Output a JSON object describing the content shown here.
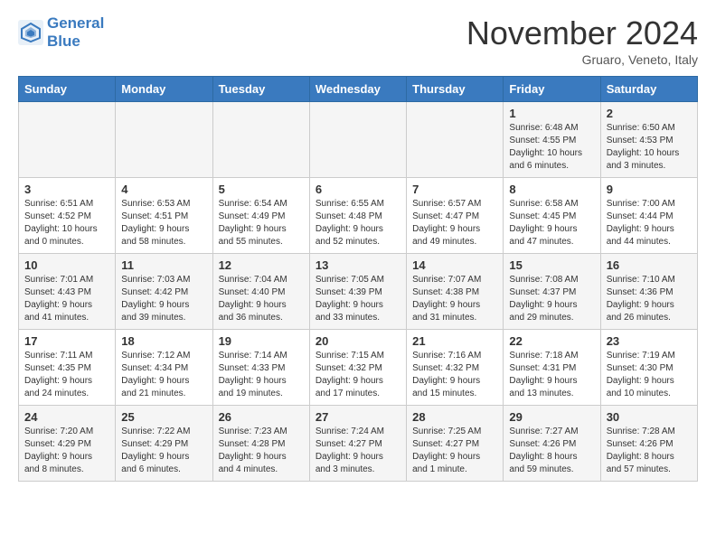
{
  "header": {
    "logo_line1": "General",
    "logo_line2": "Blue",
    "month": "November 2024",
    "location": "Gruaro, Veneto, Italy"
  },
  "weekdays": [
    "Sunday",
    "Monday",
    "Tuesday",
    "Wednesday",
    "Thursday",
    "Friday",
    "Saturday"
  ],
  "weeks": [
    [
      {
        "day": "",
        "info": ""
      },
      {
        "day": "",
        "info": ""
      },
      {
        "day": "",
        "info": ""
      },
      {
        "day": "",
        "info": ""
      },
      {
        "day": "",
        "info": ""
      },
      {
        "day": "1",
        "info": "Sunrise: 6:48 AM\nSunset: 4:55 PM\nDaylight: 10 hours and 6 minutes."
      },
      {
        "day": "2",
        "info": "Sunrise: 6:50 AM\nSunset: 4:53 PM\nDaylight: 10 hours and 3 minutes."
      }
    ],
    [
      {
        "day": "3",
        "info": "Sunrise: 6:51 AM\nSunset: 4:52 PM\nDaylight: 10 hours and 0 minutes."
      },
      {
        "day": "4",
        "info": "Sunrise: 6:53 AM\nSunset: 4:51 PM\nDaylight: 9 hours and 58 minutes."
      },
      {
        "day": "5",
        "info": "Sunrise: 6:54 AM\nSunset: 4:49 PM\nDaylight: 9 hours and 55 minutes."
      },
      {
        "day": "6",
        "info": "Sunrise: 6:55 AM\nSunset: 4:48 PM\nDaylight: 9 hours and 52 minutes."
      },
      {
        "day": "7",
        "info": "Sunrise: 6:57 AM\nSunset: 4:47 PM\nDaylight: 9 hours and 49 minutes."
      },
      {
        "day": "8",
        "info": "Sunrise: 6:58 AM\nSunset: 4:45 PM\nDaylight: 9 hours and 47 minutes."
      },
      {
        "day": "9",
        "info": "Sunrise: 7:00 AM\nSunset: 4:44 PM\nDaylight: 9 hours and 44 minutes."
      }
    ],
    [
      {
        "day": "10",
        "info": "Sunrise: 7:01 AM\nSunset: 4:43 PM\nDaylight: 9 hours and 41 minutes."
      },
      {
        "day": "11",
        "info": "Sunrise: 7:03 AM\nSunset: 4:42 PM\nDaylight: 9 hours and 39 minutes."
      },
      {
        "day": "12",
        "info": "Sunrise: 7:04 AM\nSunset: 4:40 PM\nDaylight: 9 hours and 36 minutes."
      },
      {
        "day": "13",
        "info": "Sunrise: 7:05 AM\nSunset: 4:39 PM\nDaylight: 9 hours and 33 minutes."
      },
      {
        "day": "14",
        "info": "Sunrise: 7:07 AM\nSunset: 4:38 PM\nDaylight: 9 hours and 31 minutes."
      },
      {
        "day": "15",
        "info": "Sunrise: 7:08 AM\nSunset: 4:37 PM\nDaylight: 9 hours and 29 minutes."
      },
      {
        "day": "16",
        "info": "Sunrise: 7:10 AM\nSunset: 4:36 PM\nDaylight: 9 hours and 26 minutes."
      }
    ],
    [
      {
        "day": "17",
        "info": "Sunrise: 7:11 AM\nSunset: 4:35 PM\nDaylight: 9 hours and 24 minutes."
      },
      {
        "day": "18",
        "info": "Sunrise: 7:12 AM\nSunset: 4:34 PM\nDaylight: 9 hours and 21 minutes."
      },
      {
        "day": "19",
        "info": "Sunrise: 7:14 AM\nSunset: 4:33 PM\nDaylight: 9 hours and 19 minutes."
      },
      {
        "day": "20",
        "info": "Sunrise: 7:15 AM\nSunset: 4:32 PM\nDaylight: 9 hours and 17 minutes."
      },
      {
        "day": "21",
        "info": "Sunrise: 7:16 AM\nSunset: 4:32 PM\nDaylight: 9 hours and 15 minutes."
      },
      {
        "day": "22",
        "info": "Sunrise: 7:18 AM\nSunset: 4:31 PM\nDaylight: 9 hours and 13 minutes."
      },
      {
        "day": "23",
        "info": "Sunrise: 7:19 AM\nSunset: 4:30 PM\nDaylight: 9 hours and 10 minutes."
      }
    ],
    [
      {
        "day": "24",
        "info": "Sunrise: 7:20 AM\nSunset: 4:29 PM\nDaylight: 9 hours and 8 minutes."
      },
      {
        "day": "25",
        "info": "Sunrise: 7:22 AM\nSunset: 4:29 PM\nDaylight: 9 hours and 6 minutes."
      },
      {
        "day": "26",
        "info": "Sunrise: 7:23 AM\nSunset: 4:28 PM\nDaylight: 9 hours and 4 minutes."
      },
      {
        "day": "27",
        "info": "Sunrise: 7:24 AM\nSunset: 4:27 PM\nDaylight: 9 hours and 3 minutes."
      },
      {
        "day": "28",
        "info": "Sunrise: 7:25 AM\nSunset: 4:27 PM\nDaylight: 9 hours and 1 minute."
      },
      {
        "day": "29",
        "info": "Sunrise: 7:27 AM\nSunset: 4:26 PM\nDaylight: 8 hours and 59 minutes."
      },
      {
        "day": "30",
        "info": "Sunrise: 7:28 AM\nSunset: 4:26 PM\nDaylight: 8 hours and 57 minutes."
      }
    ]
  ]
}
